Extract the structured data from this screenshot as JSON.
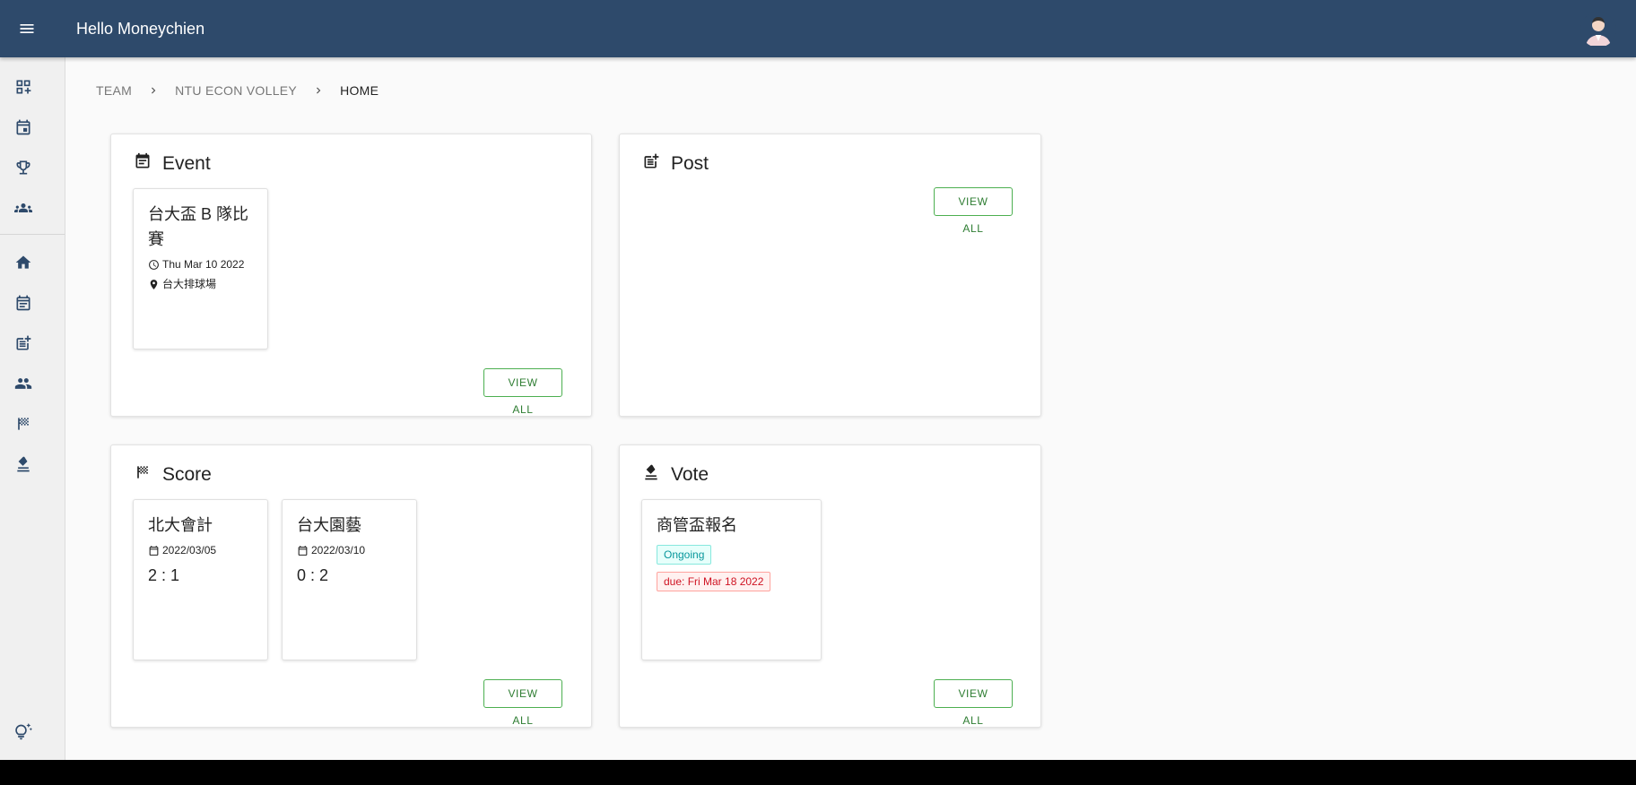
{
  "header": {
    "title": "Hello Moneychien"
  },
  "breadcrumb": {
    "items": [
      "TEAM",
      "NTU ECON VOLLEY",
      "HOME"
    ]
  },
  "event": {
    "title": "Event",
    "view_all": "VIEW ALL",
    "items": [
      {
        "title": "台大盃 B 隊比賽",
        "date": "Thu Mar 10 2022",
        "location": "台大排球場"
      }
    ]
  },
  "post": {
    "title": "Post",
    "view_all": "VIEW ALL"
  },
  "score": {
    "title": "Score",
    "view_all": "VIEW ALL",
    "items": [
      {
        "opponent": "北大會計",
        "date": "2022/03/05",
        "result": "2 : 1"
      },
      {
        "opponent": "台大園藝",
        "date": "2022/03/10",
        "result": "0 : 2"
      }
    ]
  },
  "vote": {
    "title": "Vote",
    "view_all": "VIEW ALL",
    "items": [
      {
        "title": "商管盃報名",
        "status": "Ongoing",
        "due": "due: Fri Mar 18 2022"
      }
    ]
  },
  "sidebar": {
    "top_icons": [
      "dashboard-add-icon",
      "calendar-icon",
      "trophy-icon",
      "groups-icon"
    ],
    "team_icons": [
      "home-icon",
      "event-icon",
      "post-add-icon",
      "people-icon",
      "sports-score-icon",
      "vote-icon"
    ],
    "bottom_icon": "tips-lightbulb-icon"
  },
  "colors": {
    "primary": "#2e4a6b",
    "accent": "#4caf50",
    "sidebar_bg": "#f0f0f0"
  }
}
